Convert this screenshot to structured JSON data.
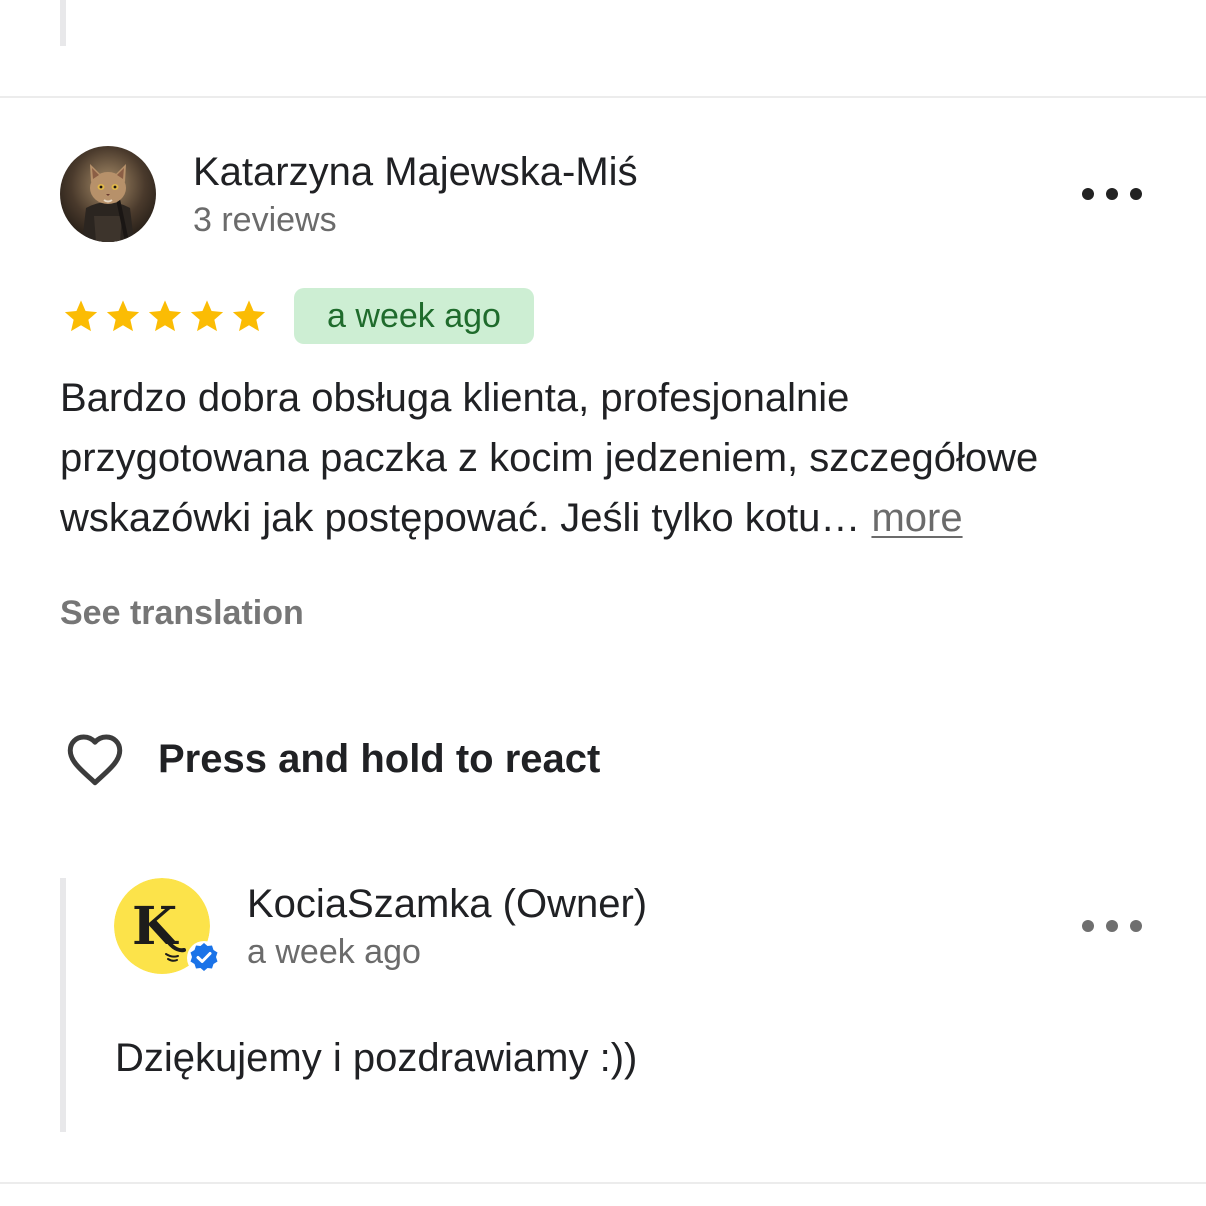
{
  "review": {
    "reviewer_name": "Katarzyna Majewska-Miś",
    "review_count": "3 reviews",
    "avatar_icon": "cat-photo-avatar",
    "rating": 5,
    "rating_max": 5,
    "date": "a week ago",
    "text_lines": [
      "Bardzo dobra obsługa klienta, profesjonalnie",
      "przygotowana paczka z kocim jedzeniem, szczegółowe",
      "wskazówki jak postępować. Jeśli tylko kotu… "
    ],
    "more_label": "more",
    "see_translation": "See translation",
    "react_label": "Press and hold to react",
    "react_icon": "heart-outline-icon",
    "menu_icon": "more-horizontal-icon"
  },
  "reply": {
    "owner_name": "KociaSzamka (Owner)",
    "date": "a week ago",
    "text": "Dziękujemy i pozdrawiamy :))",
    "avatar_letter": "K",
    "avatar_icon": "kociaszamka-logo-avatar",
    "verified_icon": "verified-check-icon",
    "menu_icon": "more-horizontal-icon"
  },
  "colors": {
    "star": "#FBBC04",
    "date_badge_bg": "#CDEED3",
    "date_badge_text": "#1F6B2C",
    "owner_avatar_bg": "#FCE34A",
    "verified": "#1A73E8"
  }
}
